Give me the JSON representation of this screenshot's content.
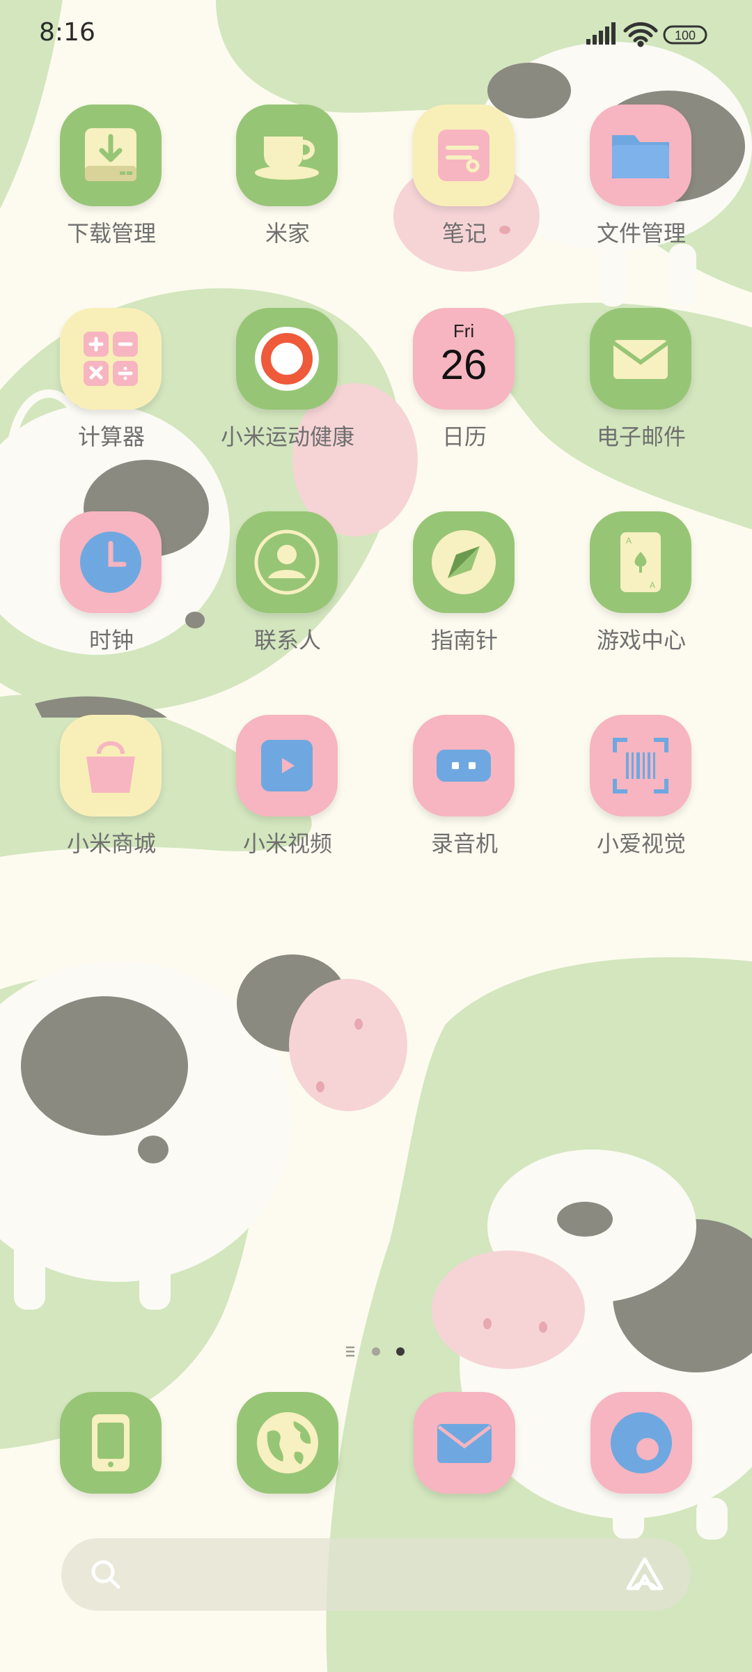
{
  "status_bar": {
    "time": "8:16",
    "battery": "100",
    "icons": [
      "signal-icon",
      "wifi-icon",
      "battery-icon"
    ]
  },
  "apps": [
    {
      "label": "下载管理",
      "icon": "download-icon",
      "color": "#97c576"
    },
    {
      "label": "米家",
      "icon": "teacup-icon",
      "color": "#97c576"
    },
    {
      "label": "笔记",
      "icon": "notes-icon",
      "color": "#f8efb8"
    },
    {
      "label": "文件管理",
      "icon": "folder-icon",
      "color": "#f6b5c0"
    },
    {
      "label": "计算器",
      "icon": "calculator-icon",
      "color": "#f8efb8"
    },
    {
      "label": "小米运动健康",
      "icon": "fitness-ring-icon",
      "color": "#97c576"
    },
    {
      "label": "日历",
      "icon": "calendar-icon",
      "color": "#f6b5c0",
      "calendar_day": "Fri",
      "calendar_date": "26"
    },
    {
      "label": "电子邮件",
      "icon": "email-icon",
      "color": "#97c576"
    },
    {
      "label": "时钟",
      "icon": "clock-icon",
      "color": "#f6b5c0"
    },
    {
      "label": "联系人",
      "icon": "contacts-icon",
      "color": "#97c576"
    },
    {
      "label": "指南针",
      "icon": "compass-icon",
      "color": "#97c576"
    },
    {
      "label": "游戏中心",
      "icon": "game-card-icon",
      "color": "#97c576"
    },
    {
      "label": "小米商城",
      "icon": "shopping-bag-icon",
      "color": "#f8efb8"
    },
    {
      "label": "小米视频",
      "icon": "video-play-icon",
      "color": "#f6b5c0"
    },
    {
      "label": "录音机",
      "icon": "recorder-icon",
      "color": "#f6b5c0"
    },
    {
      "label": "小爱视觉",
      "icon": "barcode-scanner-icon",
      "color": "#f6b5c0"
    }
  ],
  "page_indicator": {
    "pages": 3,
    "current": 3
  },
  "dock": [
    {
      "icon": "phone-icon",
      "color": "#97c576"
    },
    {
      "icon": "browser-globe-icon",
      "color": "#97c576"
    },
    {
      "icon": "messages-icon",
      "color": "#f6b5c0"
    },
    {
      "icon": "camera-icon",
      "color": "#f6b5c0"
    }
  ],
  "search_bar": {
    "icons": [
      "search-icon",
      "assistant-icon"
    ]
  }
}
